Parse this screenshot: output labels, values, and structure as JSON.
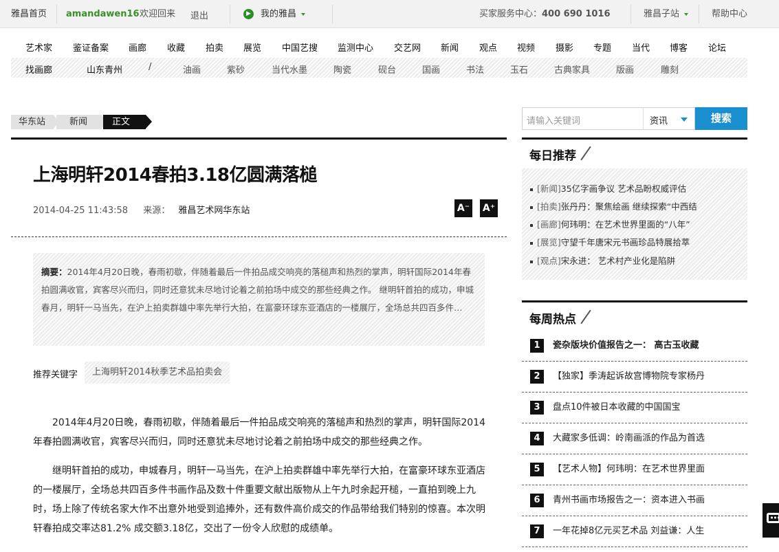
{
  "topbar": {
    "home": "雅昌首页",
    "username": "amandawen16",
    "welcome": "欢迎回来",
    "logout": "退出",
    "my_yachang": "我的雅昌",
    "buyer_service": "买家服务中心：",
    "hotline": "400 690 1016",
    "sub_sites": "雅昌子站",
    "help": "帮助中心"
  },
  "nav": [
    "艺术家",
    "鉴证备案",
    "画廊",
    "收藏",
    "拍卖",
    "展览",
    "中国艺搜",
    "监测中心",
    "交艺网",
    "新闻",
    "观点",
    "视频",
    "摄影",
    "专题",
    "当代",
    "博客",
    "论坛"
  ],
  "subnav": {
    "find_gallery": "找画廊",
    "region": "山东青州",
    "divider": "/",
    "items": [
      "油画",
      "紫砂",
      "当代水墨",
      "陶瓷",
      "砚台",
      "国画",
      "书法",
      "玉石",
      "古典家具",
      "版画",
      "雕刻"
    ]
  },
  "breadcrumb": [
    "华东站",
    "新闻",
    "正文"
  ],
  "article": {
    "title": "上海明轩2014春拍3.18亿圆满落槌",
    "date": "2014-04-25 11:43:58",
    "source_label": "来源：",
    "source": "雅昌艺术网华东站",
    "font_smaller": "A⁻",
    "font_larger": "A⁺",
    "summary_label": "摘要：",
    "summary": "2014年4月20日晚，春雨初歇，伴随着最后一件拍品成交响亮的落槌声和热烈的掌声，明轩国际2014年春拍圆满收官，宾客尽兴而归，同时还意犹未尽地讨论着之前拍场中成交的那些经典之作。 继明轩首拍的成功，申城春月，明轩一马当先，在沪上拍卖群雄中率先举行大拍，在富豪环球东亚酒店的一楼展厅，全场总共四百多件…",
    "keywords_label": "推荐关键字",
    "keyword": "上海明轩2014秋季艺术品拍卖会",
    "paragraphs": [
      "2014年4月20日晚，春雨初歇，伴随着最后一件拍品成交响亮的落槌声和热烈的掌声，明轩国际2014年春拍圆满收官，宾客尽兴而归，同时还意犹未尽地讨论着之前拍场中成交的那些经典之作。",
      "继明轩首拍的成功，申城春月，明轩一马当先，在沪上拍卖群雄中率先举行大拍，在富豪环球东亚酒店的一楼展厅，全场总共四百多件书画作品及数十件重要文献出版物从上午九时余起开槌，一直拍到晚上九时，场上除了传统名家大作不出意外地受到追捧外，还有数件高价成交的作品带给我们特别的惊喜。本次明轩春拍成交率达81.2%  成交额3.18亿，交出了一份令人欣慰的成绩单。"
    ]
  },
  "search": {
    "placeholder": "请输入关键词",
    "category": "资讯",
    "button": "搜索"
  },
  "daily": {
    "title": "每日推荐",
    "items": [
      {
        "cat": "[新闻]",
        "text": "35亿字画争议 艺术品盼权威评估"
      },
      {
        "cat": "[拍卖]",
        "text": "张丹丹：聚焦绘画 继续探索“中西结"
      },
      {
        "cat": "[画廊]",
        "text": "何玮明：在艺术世界里面的“八年”"
      },
      {
        "cat": "[展览]",
        "text": "守望千年唐宋元书画珍品特展拾萃"
      },
      {
        "cat": "[观点]",
        "text": "宋永进： 艺术村产业化是陷阱"
      }
    ]
  },
  "weekly": {
    "title": "每周热点",
    "items": [
      {
        "num": "1",
        "text": "瓷杂版块价值报告之一： 高古玉收藏"
      },
      {
        "num": "2",
        "text": "【独家】季涛起诉故宫博物院专家杨丹"
      },
      {
        "num": "3",
        "text": "盘点10件被日本收藏的中国国宝"
      },
      {
        "num": "4",
        "text": "大藏家多低调：岭南画派的作品为首选"
      },
      {
        "num": "5",
        "text": "【艺术人物】何玮明：在艺术世界里面"
      },
      {
        "num": "6",
        "text": "青州书画市场报告之一：资本进入书画"
      },
      {
        "num": "7",
        "text": "一年花掉8亿元买艺术品 刘益谦：人生"
      }
    ]
  },
  "icons": {
    "yachang_logo": "yachang-logo-icon",
    "chat": "chat-icon"
  },
  "colors": {
    "accent_blue": "#1a8fd0",
    "username_green": "#3a8f2a"
  }
}
